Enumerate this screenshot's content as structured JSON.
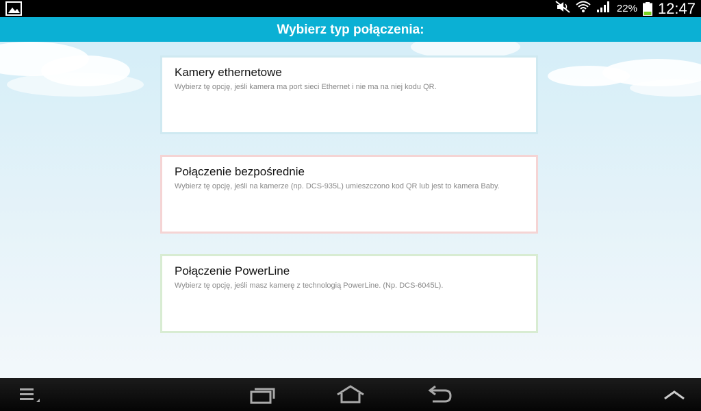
{
  "status_bar": {
    "battery_percent": "22%",
    "time": "12:47",
    "icons": [
      "image-icon",
      "mute-icon",
      "wifi-icon",
      "signal-icon",
      "battery-icon"
    ]
  },
  "header": {
    "title": "Wybierz typ połączenia:"
  },
  "options": [
    {
      "title": "Kamery ethernetowe",
      "description": "Wybierz tę opcję, jeśli kamera ma port sieci Ethernet i nie ma na niej kodu QR.",
      "accent": "#cfe9f1"
    },
    {
      "title": "Połączenie bezpośrednie",
      "description": "Wybierz tę opcję, jeśli na kamerze (np. DCS-935L) umieszczono kod QR lub jest to kamera Baby.",
      "accent": "#f5d4d4"
    },
    {
      "title": "Połączenie PowerLine",
      "description": "Wybierz tę opcję, jeśli masz kamerę z technologią PowerLine. (Np. DCS-6045L).",
      "accent": "#d8ecd2"
    }
  ],
  "nav_bar": {
    "buttons": [
      "menu-icon",
      "recent-apps-icon",
      "home-icon",
      "back-icon",
      "expand-up-icon"
    ]
  },
  "colors": {
    "header_bg": "#0bb0d4",
    "status_bg": "#000000",
    "nav_bg": "#111111"
  }
}
